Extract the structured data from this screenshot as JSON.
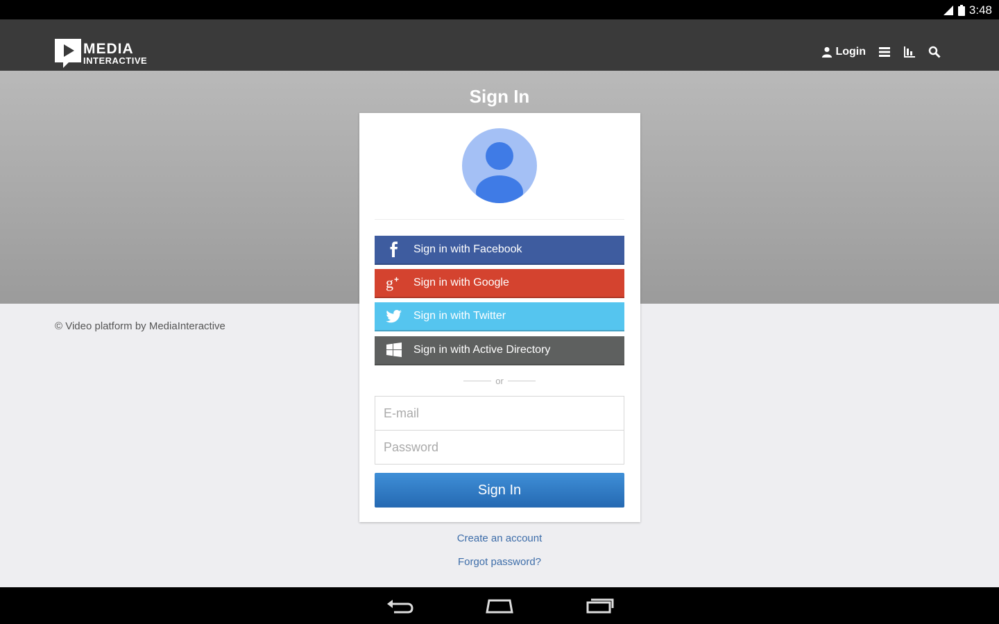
{
  "status_bar": {
    "time": "3:48"
  },
  "header": {
    "logo": {
      "line1": "MEDIA",
      "line2": "INTERACTIVE"
    },
    "nav": {
      "login_label": "Login",
      "icons": [
        "user-icon",
        "list-icon",
        "chart-icon",
        "search-icon"
      ]
    }
  },
  "page": {
    "title": "Sign In"
  },
  "footer": {
    "copyright": "© Video platform by MediaInteractive"
  },
  "card": {
    "social_buttons": [
      {
        "label": "Sign in with Facebook",
        "icon": "facebook-icon",
        "color": "#3e5c9f"
      },
      {
        "label": "Sign in with Google",
        "icon": "google-plus-icon",
        "color": "#d4432f"
      },
      {
        "label": "Sign in with Twitter",
        "icon": "twitter-icon",
        "color": "#55c5ef"
      },
      {
        "label": "Sign in with Active Directory",
        "icon": "windows-icon",
        "color": "#5e605f"
      }
    ],
    "separator": "or",
    "email": {
      "placeholder": "E-mail",
      "value": ""
    },
    "password": {
      "placeholder": "Password",
      "value": ""
    },
    "submit_label": "Sign In"
  },
  "links": {
    "create_account": "Create an account",
    "forgot_password": "Forgot password?"
  },
  "colors": {
    "accent": "#2a74bf",
    "header_bg": "#3a3a3a",
    "link": "#3d6da9"
  },
  "android_nav": [
    "back-icon",
    "home-icon",
    "recent-apps-icon"
  ]
}
